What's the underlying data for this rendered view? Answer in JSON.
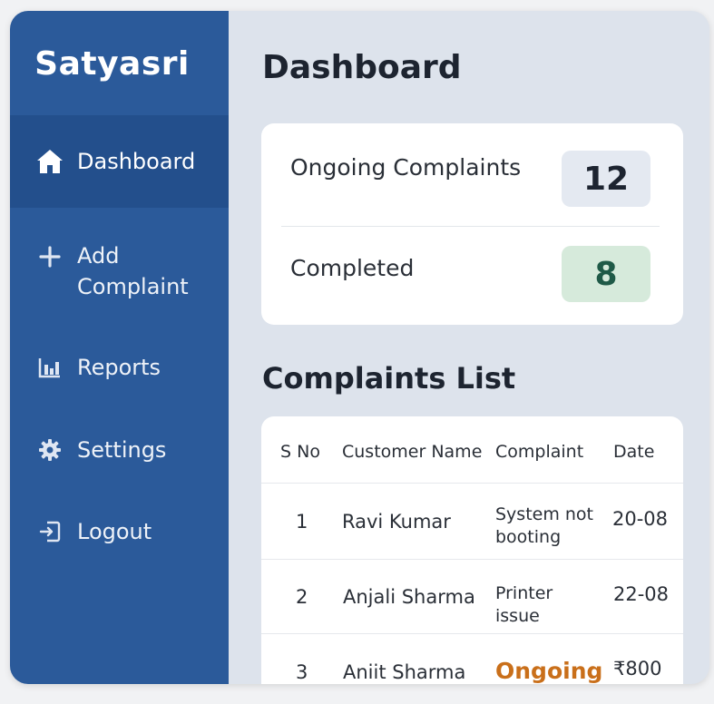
{
  "brand": "Satyasri",
  "sidebar": {
    "items": [
      {
        "label": "Dashboard",
        "icon": "home-icon",
        "active": true
      },
      {
        "label": "Add Complaint",
        "icon": "plus-icon",
        "active": false
      },
      {
        "label": "Reports",
        "icon": "bar-chart-icon",
        "active": false
      },
      {
        "label": "Settings",
        "icon": "gear-icon",
        "active": false
      },
      {
        "label": "Logout",
        "icon": "logout-icon",
        "active": false
      }
    ]
  },
  "main": {
    "title": "Dashboard",
    "stats": [
      {
        "label": "Ongoing Complaints",
        "value": "12"
      },
      {
        "label": "Completed",
        "value": "8"
      }
    ],
    "list_title": "Complaints List",
    "table": {
      "headers": [
        "S No",
        "Customer Name",
        "Complaint",
        "Date"
      ],
      "rows": [
        {
          "sno": "1",
          "name": "Ravi Kumar",
          "complaint": "System not booting",
          "date": "20-08"
        },
        {
          "sno": "2",
          "name": "Anjali Sharma",
          "complaint": "Printer issue",
          "date": "22-08"
        },
        {
          "sno": "3",
          "name": "Aniit Sharma",
          "complaint": "Ongoing",
          "date": "₹800"
        }
      ]
    }
  },
  "colors": {
    "sidebar": "#2b5a9a",
    "sidebar_active": "#234f8c",
    "content_bg": "#dde3ec",
    "ongoing_badge": "#e4e9f1",
    "completed_badge": "#d6eadb",
    "completed_text": "#1f5a47",
    "status_ongoing": "#c96f1a"
  }
}
